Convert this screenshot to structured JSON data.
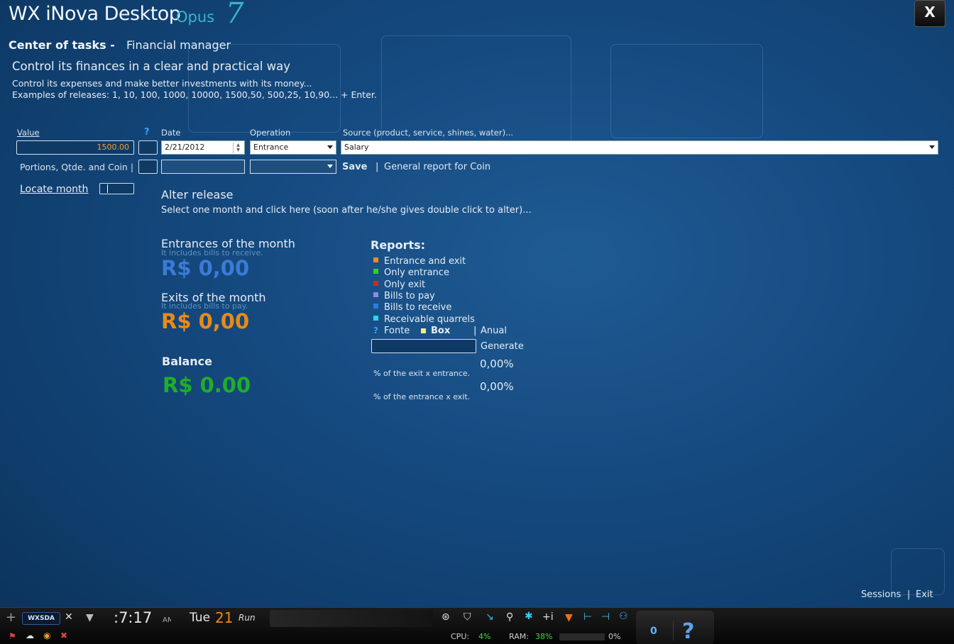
{
  "app": {
    "title": "WX iNova Desktop",
    "opus": "Opus",
    "version": "7",
    "close_label": "X"
  },
  "header": {
    "crumb_bold": "Center of tasks -",
    "crumb_sub": "Financial manager",
    "tagline": "Control its finances in a clear and practical way",
    "desc1": "Control its expenses and make better investments with its money...",
    "desc2": "Examples of releases: 1, 10, 100, 1000, 10000, 1500,50, 500,25, 10,90... + Enter."
  },
  "form": {
    "value_label": "Value",
    "value": "1500.00",
    "help": "?",
    "date_label": "Date",
    "date": "2/21/2012",
    "operation_label": "Operation",
    "operation": "Entrance",
    "source_label": "Source (product, service, shines, water)...",
    "source": "Salary",
    "portions_label": "Portions, Qtde. and Coin |",
    "save_label": "Save",
    "separator": "|",
    "report_coin_label": "General report for Coin",
    "locate_label": "Locate month"
  },
  "alter": {
    "title": "Alter release",
    "hint": "Select one month and click here (soon after he/she gives double click to alter)..."
  },
  "summary": {
    "entrances_title": "Entrances of the month",
    "entrances_sub": "It includes bills to receive.",
    "entrances_value": "R$ 0,00",
    "exits_title": "Exits of the month",
    "exits_sub": "It includes bills to pay.",
    "exits_value": "R$ 0,00",
    "balance_title": "Balance",
    "balance_value": "R$ 0.00"
  },
  "reports": {
    "title": "Reports:",
    "items": [
      {
        "label": "Entrance and exit",
        "color": "#f08a1a"
      },
      {
        "label": "Only entrance",
        "color": "#2fd12f"
      },
      {
        "label": "Only exit",
        "color": "#e02020"
      },
      {
        "label": "Bills to pay",
        "color": "#8a8ae8"
      },
      {
        "label": "Bills to receive",
        "color": "#2a7de0"
      },
      {
        "label": "Receivable quarrels",
        "color": "#2ad6e6"
      }
    ],
    "fonte_q": "?",
    "fonte": "Fonte",
    "box": "Box",
    "anual_sep": "|",
    "anual": "Anual",
    "generate": "Generate",
    "pct1_label": "% of the exit x entrance.",
    "pct1_value": "0,00%",
    "pct2_label": "% of the entrance x exit.",
    "pct2_value": "0,00%"
  },
  "footer": {
    "sessions": "Sessions",
    "sep": "|",
    "exit": "Exit"
  },
  "taskbar": {
    "plus": "+",
    "brand": "WXSDA",
    "time": ":7:17",
    "am": "AM",
    "day": "Tue",
    "date_num": "21",
    "run": "Run",
    "cpu_label": "CPU:",
    "cpu_value": "4%",
    "ram_label": "RAM:",
    "ram_value": "38%",
    "disk_value": "0%",
    "counter": "0",
    "help": "?"
  }
}
